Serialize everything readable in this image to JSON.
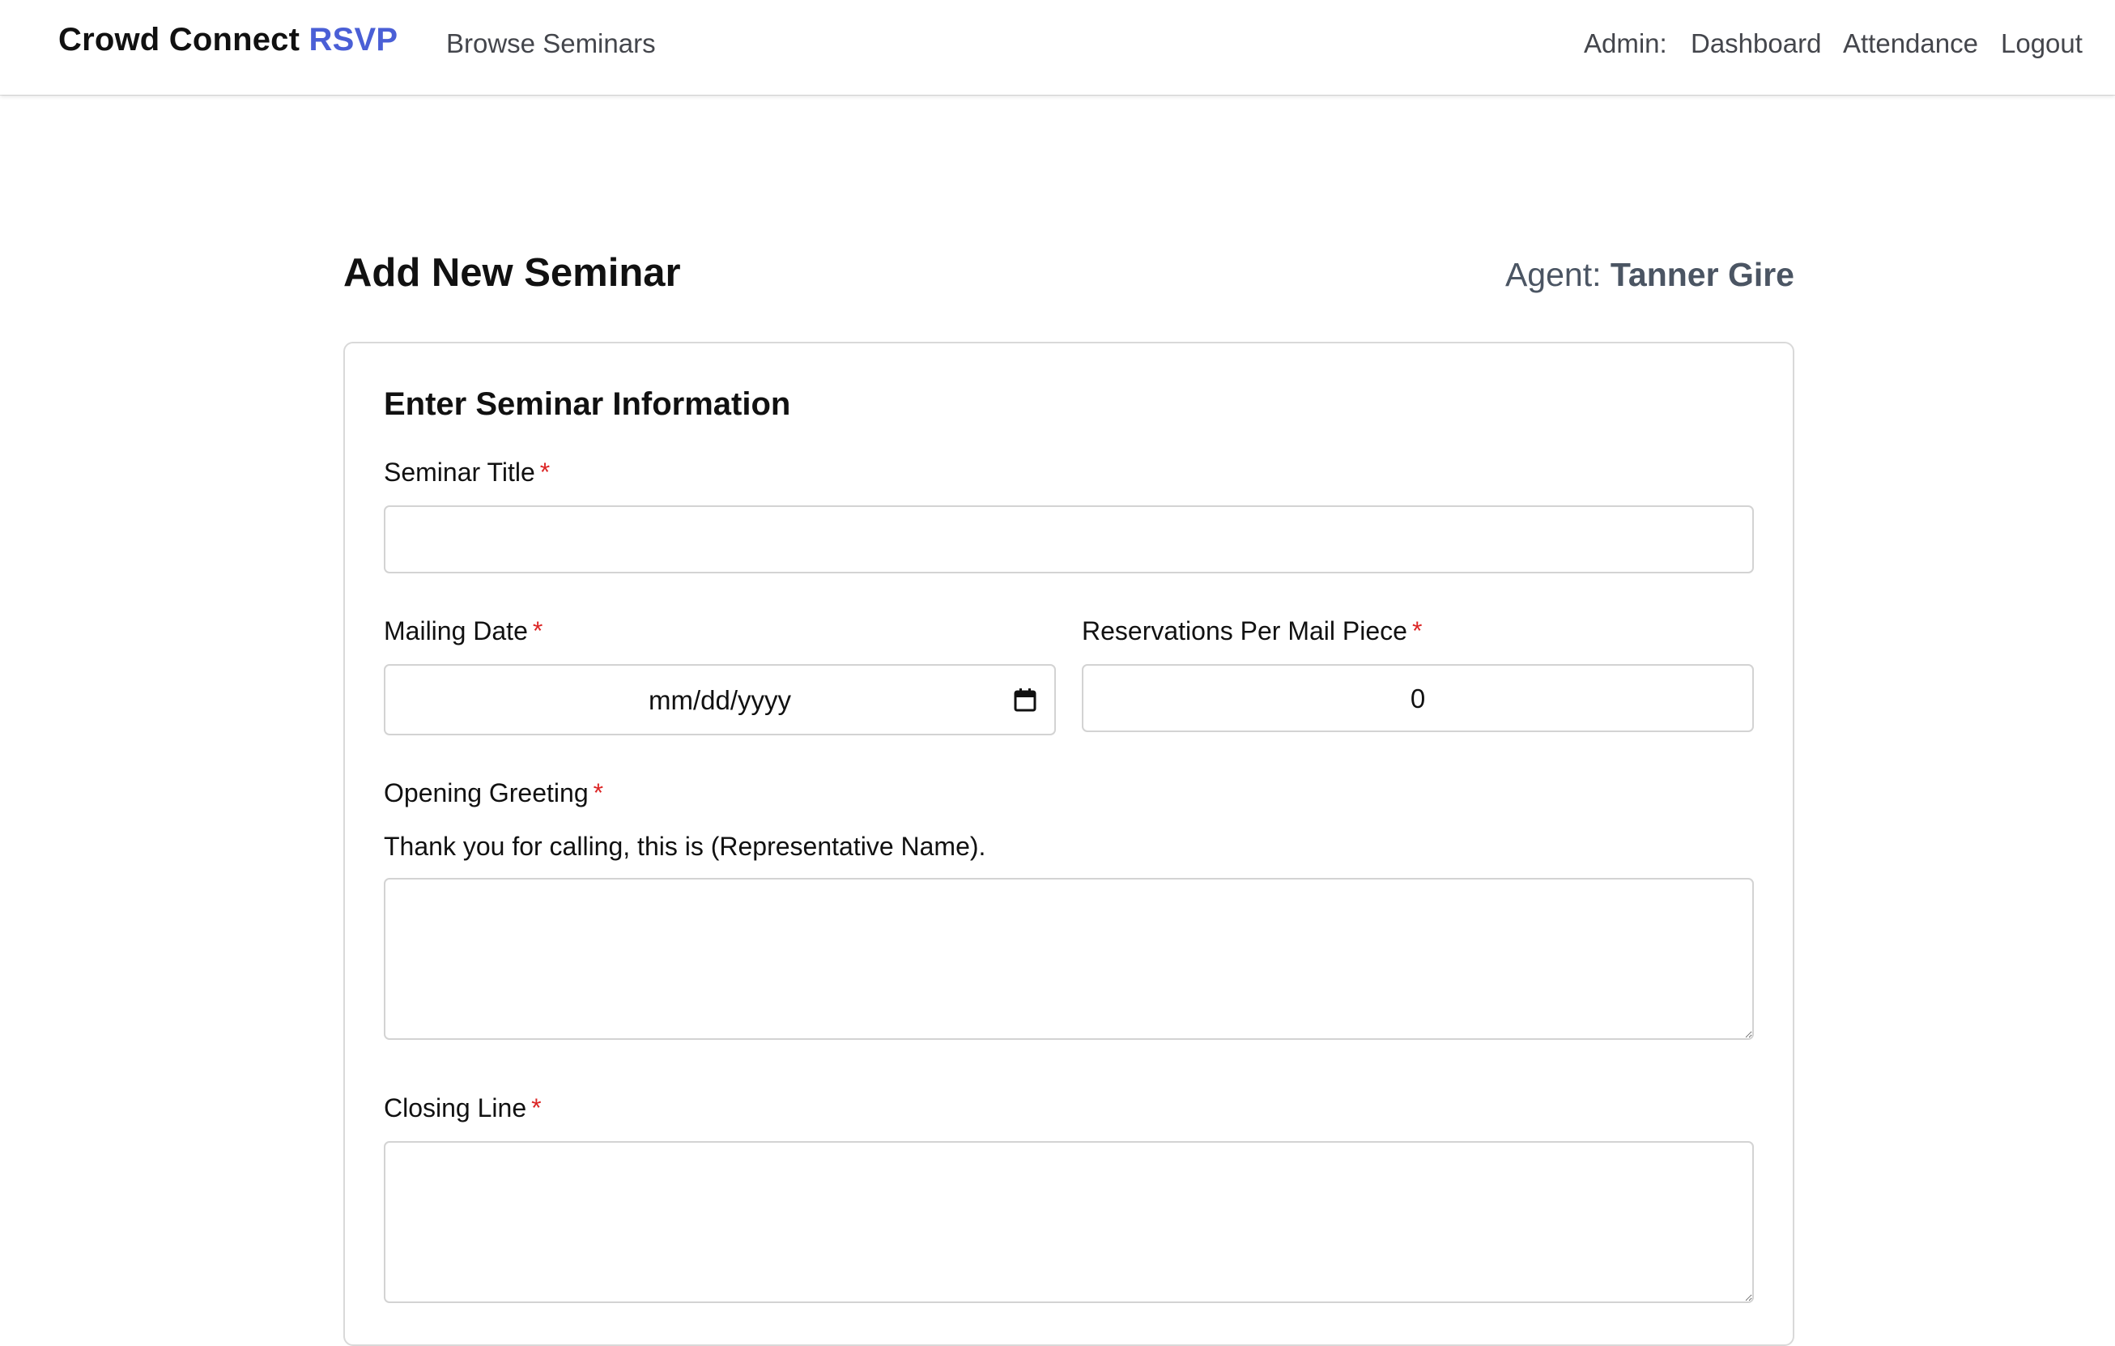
{
  "nav": {
    "brand_main": "Crowd Connect",
    "brand_accent": "RSVP",
    "browse_seminars": "Browse Seminars",
    "admin_label": "Admin:",
    "dashboard": "Dashboard",
    "attendance": "Attendance",
    "logout": "Logout"
  },
  "header": {
    "title": "Add New Seminar",
    "agent_label": "Agent:",
    "agent_name": "Tanner Gire"
  },
  "form": {
    "card_title": "Enter Seminar Information",
    "required_mark": "*",
    "seminar_title": {
      "label": "Seminar Title",
      "value": ""
    },
    "mailing_date": {
      "label": "Mailing Date",
      "placeholder": "mm/dd/yyyy"
    },
    "reservations": {
      "label": "Reservations Per Mail Piece",
      "value": "0"
    },
    "opening_greeting": {
      "label": "Opening Greeting",
      "helper": "Thank you for calling, this is (Representative Name).",
      "value": ""
    },
    "closing_line": {
      "label": "Closing Line",
      "value": ""
    }
  },
  "colors": {
    "brand_accent": "#4a5fd6",
    "required": "#dc2626",
    "agent_text": "#4b5563"
  },
  "icons": {
    "date_picker": "calendar-icon"
  }
}
